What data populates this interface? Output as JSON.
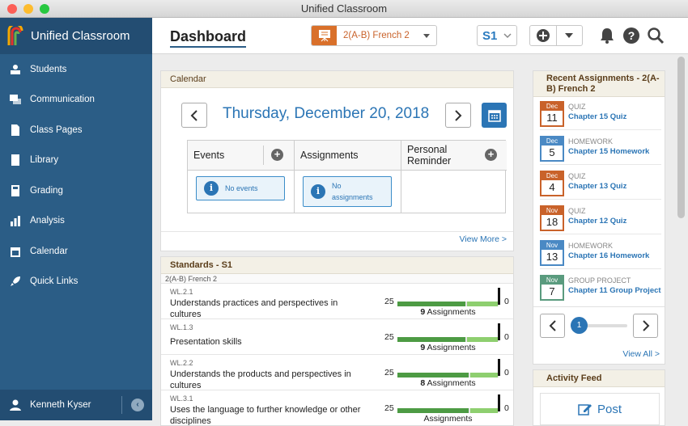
{
  "window": {
    "title": "Unified Classroom"
  },
  "sidebar": {
    "brand": "Unified Classroom",
    "items": [
      {
        "label": "Students",
        "icon": "students-icon"
      },
      {
        "label": "Communication",
        "icon": "communication-icon"
      },
      {
        "label": "Class Pages",
        "icon": "class-pages-icon"
      },
      {
        "label": "Library",
        "icon": "library-icon"
      },
      {
        "label": "Grading",
        "icon": "calculator-icon"
      },
      {
        "label": "Analysis",
        "icon": "bar-chart-icon"
      },
      {
        "label": "Calendar",
        "icon": "calendar-icon"
      },
      {
        "label": "Quick Links",
        "icon": "rocket-icon"
      }
    ],
    "user": "Kenneth Kyser"
  },
  "header": {
    "title": "Dashboard",
    "class_selector": "2(A-B) French 2",
    "semester": "S1"
  },
  "calendar": {
    "header": "Calendar",
    "date": "Thursday, December 20, 2018",
    "columns": [
      "Events",
      "Assignments",
      "Personal Reminder"
    ],
    "no_events": "No events",
    "no_assignments": "No assignments",
    "view_more": "View More >"
  },
  "standards": {
    "header": "Standards - S1",
    "course": "2(A-B) French 2",
    "rows": [
      {
        "code": "WL.2.1",
        "desc": "Understands practices and perspectives in cultures",
        "left": "25",
        "right": "0",
        "count": "9",
        "count_label": "Assignments"
      },
      {
        "code": "WL.1.3",
        "desc": "Presentation skills",
        "left": "25",
        "right": "0",
        "count": "9",
        "count_label": "Assignments"
      },
      {
        "code": "WL.2.2",
        "desc": "Understands the products and perspectives in cultures",
        "left": "25",
        "right": "0",
        "count": "8",
        "count_label": "Assignments"
      },
      {
        "code": "WL.3.1",
        "desc": "Uses the language to further knowledge or other disciplines",
        "left": "25",
        "right": "0",
        "count": "",
        "count_label": "Assignments"
      }
    ]
  },
  "recent": {
    "header": "Recent Assignments - 2(A-B) French 2",
    "items": [
      {
        "month": "Dec",
        "day": "11",
        "type": "QUIZ",
        "name": "Chapter 15 Quiz",
        "color": "#c9622a"
      },
      {
        "month": "Dec",
        "day": "5",
        "type": "HOMEWORK",
        "name": "Chapter 15 Homework",
        "color": "#4a89c4"
      },
      {
        "month": "Dec",
        "day": "4",
        "type": "QUIZ",
        "name": "Chapter 13 Quiz",
        "color": "#c9622a"
      },
      {
        "month": "Nov",
        "day": "18",
        "type": "QUIZ",
        "name": "Chapter 12 Quiz",
        "color": "#c9622a"
      },
      {
        "month": "Nov",
        "day": "13",
        "type": "HOMEWORK",
        "name": "Chapter 16 Homework",
        "color": "#4a89c4"
      },
      {
        "month": "Nov",
        "day": "7",
        "type": "GROUP PROJECT",
        "name": "Chapter 11 Group Project",
        "color": "#5a9b7e"
      }
    ],
    "page": "1",
    "view_all": "View All >"
  },
  "activity": {
    "header": "Activity Feed",
    "post": "Post"
  },
  "colors": {
    "sidebar": "#2b5d86",
    "accent": "#2b75b5",
    "orange": "#d9702a",
    "green_bar": "#4d9b44"
  }
}
